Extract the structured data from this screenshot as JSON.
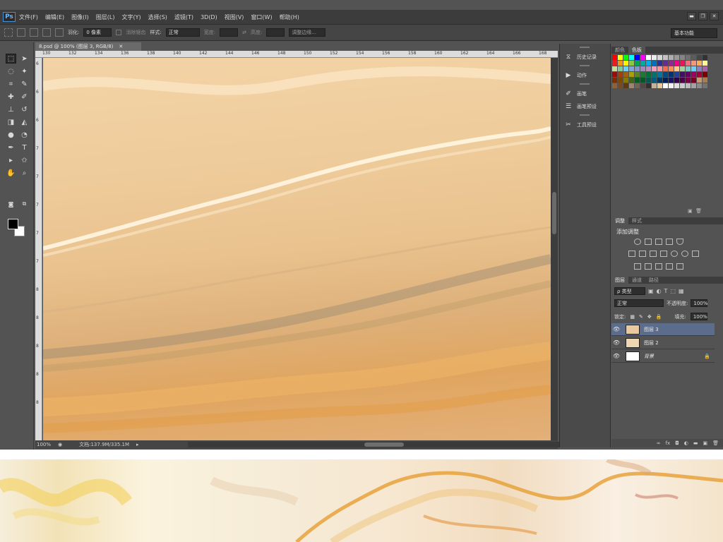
{
  "menubar": {
    "logo": "Ps",
    "items": [
      "文件(F)",
      "编辑(E)",
      "图像(I)",
      "图层(L)",
      "文字(Y)",
      "选择(S)",
      "滤镜(T)",
      "3D(D)",
      "视图(V)",
      "窗口(W)",
      "帮助(H)"
    ],
    "window_controls": [
      "▬",
      "❐",
      "✕"
    ]
  },
  "options_bar": {
    "feather_label": "羽化:",
    "feather_value": "0 像素",
    "antialias_label": "消除锯齿",
    "style_label": "样式:",
    "style_value": "正常",
    "width_label": "宽度:",
    "height_label": "高度:",
    "refine_edge_button": "调整边缘...",
    "workspace_select": "基本功能"
  },
  "document": {
    "tab_title": "8.psd @ 100% (图层 3, RGB/8)",
    "tab_close": "✕",
    "ruler_top_labels": [
      "130",
      "132",
      "134",
      "136",
      "138",
      "140",
      "142",
      "144",
      "146",
      "148",
      "150",
      "152",
      "154",
      "156",
      "158",
      "160",
      "162",
      "164",
      "166",
      "168"
    ],
    "ruler_left_labels": [
      "6",
      "6",
      "6",
      "7",
      "7",
      "7",
      "7",
      "7",
      "8",
      "8",
      "8",
      "8",
      "8"
    ],
    "zoom": "100%",
    "doc_size": "文档:137.9M/335.1M"
  },
  "dock": {
    "items": [
      "历史记录",
      "动作",
      "画笔",
      "画笔预设",
      "工具预设"
    ]
  },
  "panels": {
    "color_tabs": [
      "颜色",
      "色板"
    ],
    "adjust_tabs": [
      "调整",
      "样式"
    ],
    "adjust_title": "添加调整",
    "layers_tabs": [
      "图层",
      "通道",
      "路径"
    ],
    "layer_kind": "ρ 类型",
    "blend_mode": "正常",
    "opacity_label": "不透明度:",
    "opacity_value": "100%",
    "lock_label": "锁定:",
    "fill_label": "填充:",
    "fill_value": "100%",
    "layers": [
      {
        "name": "图层 3",
        "selected": true
      },
      {
        "name": "图层 2",
        "selected": false
      },
      {
        "name": "背景",
        "selected": false
      }
    ],
    "footer_icons": [
      "∞",
      "fx",
      "◘",
      "◐",
      "▬",
      "▣",
      "🗑"
    ]
  },
  "colors": {
    "app_bg": "#535353",
    "menubar": "#3c3c3c",
    "selected_layer": "#5b6d8a",
    "canvas_marble": "#e9c28e"
  }
}
